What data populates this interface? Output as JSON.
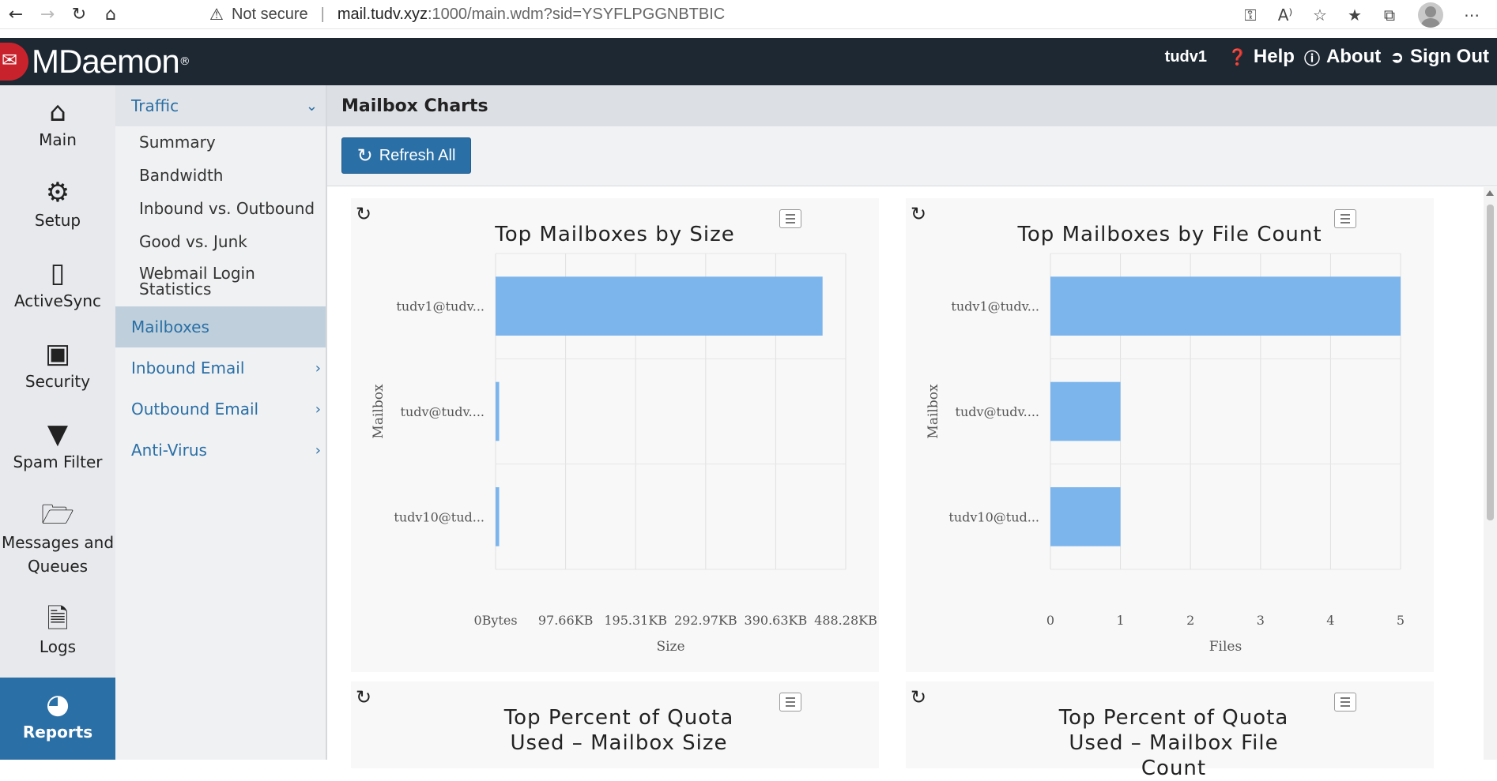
{
  "browser": {
    "security_label": "Not secure",
    "url_host": "mail.tudv.xyz",
    "url_path": ":1000/main.wdm?sid=YSYFLPGGNBTBIC"
  },
  "header": {
    "brand": "MDaemon",
    "user": "tudv1",
    "help": "Help",
    "about": "About",
    "sign_out": "Sign Out"
  },
  "icon_nav": [
    {
      "label": "Main",
      "icon": "home-icon"
    },
    {
      "label": "Setup",
      "icon": "gears-icon"
    },
    {
      "label": "ActiveSync",
      "icon": "mobile-icon"
    },
    {
      "label": "Security",
      "icon": "lock-icon"
    },
    {
      "label": "Spam Filter",
      "icon": "filter-icon"
    },
    {
      "label": "Messages and Queues",
      "icon": "folder-open-icon"
    },
    {
      "label": "Logs",
      "icon": "document-icon"
    },
    {
      "label": "Reports",
      "icon": "dashboard-icon"
    }
  ],
  "sub_nav": {
    "traffic": "Traffic",
    "traffic_items": [
      "Summary",
      "Bandwidth",
      "Inbound vs. Outbound",
      "Good vs. Junk",
      "Webmail Login Statistics"
    ],
    "mailboxes": "Mailboxes",
    "inbound_email": "Inbound Email",
    "outbound_email": "Outbound Email",
    "anti_virus": "Anti-Virus"
  },
  "page": {
    "title": "Mailbox Charts",
    "refresh_all": "Refresh All"
  },
  "charts": {
    "size_title": "Top Mailboxes by Size",
    "count_title": "Top Mailboxes by File Count",
    "quota_size_title": "Top Percent of Quota Used – Mailbox Size",
    "quota_count_title": "Top Percent of Quota Used – Mailbox File Count"
  },
  "chart_data": [
    {
      "type": "bar",
      "orientation": "horizontal",
      "title": "Top Mailboxes by Size",
      "categories": [
        "tudv1@tudv...",
        "tudv@tudv....",
        "tudv10@tud..."
      ],
      "values_kb": [
        456,
        5,
        5
      ],
      "xlabel": "Size",
      "ylabel": "Mailbox",
      "xticks": [
        "0Bytes",
        "97.66KB",
        "195.31KB",
        "292.97KB",
        "390.63KB",
        "488.28KB"
      ],
      "xlim_kb": [
        0,
        488.28
      ],
      "color": "#7cb5ec",
      "grid": true
    },
    {
      "type": "bar",
      "orientation": "horizontal",
      "title": "Top Mailboxes by File Count",
      "categories": [
        "tudv1@tudv...",
        "tudv@tudv....",
        "tudv10@tud..."
      ],
      "values": [
        5,
        1,
        1
      ],
      "xlabel": "Files",
      "ylabel": "Mailbox",
      "xticks": [
        "0",
        "1",
        "2",
        "3",
        "4",
        "5"
      ],
      "xlim": [
        0,
        5
      ],
      "color": "#7cb5ec",
      "grid": true
    }
  ]
}
